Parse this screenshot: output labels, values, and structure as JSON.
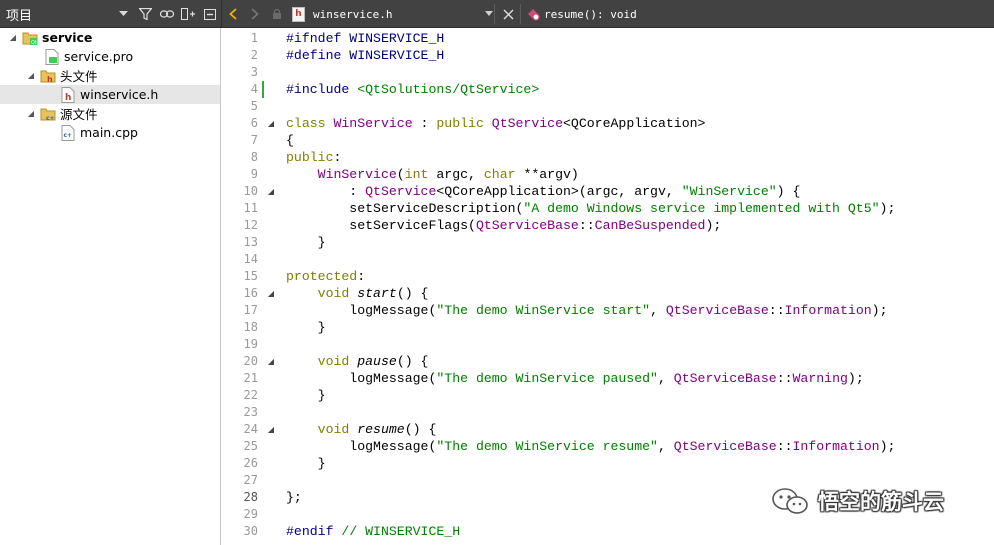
{
  "toolbar": {
    "project_title": "项目",
    "icons": [
      "chevron-down-icon",
      "filter-icon",
      "link-icon",
      "split-icon",
      "close-pane-icon"
    ],
    "current_file": "winservice.h",
    "current_file_icon_glyph": "h",
    "current_symbol": "resume(): void"
  },
  "project_tree": {
    "root": {
      "label": "service"
    },
    "items": [
      {
        "label": "service.pro"
      },
      {
        "label": "头文件"
      },
      {
        "label": "winservice.h"
      },
      {
        "label": "源文件"
      },
      {
        "label": "main.cpp"
      }
    ]
  },
  "editor": {
    "current_line": "28",
    "lines": [
      {
        "n": "1",
        "segs": [
          [
            "pp",
            "#ifndef WINSERVICE_H"
          ]
        ]
      },
      {
        "n": "2",
        "segs": [
          [
            "pp",
            "#define WINSERVICE_H"
          ]
        ]
      },
      {
        "n": "3",
        "segs": []
      },
      {
        "n": "4",
        "segs": [
          [
            "pp",
            "#include "
          ],
          [
            "str",
            "<QtSolutions/QtService>"
          ]
        ]
      },
      {
        "n": "5",
        "segs": []
      },
      {
        "n": "6",
        "segs": [
          [
            "kw",
            "class "
          ],
          [
            "ty",
            "WinService"
          ],
          [
            "",
            " : "
          ],
          [
            "kw",
            "public "
          ],
          [
            "ty",
            "QtService"
          ],
          [
            "",
            "<QCoreApplication>"
          ]
        ]
      },
      {
        "n": "7",
        "segs": [
          [
            "",
            "{"
          ]
        ]
      },
      {
        "n": "8",
        "segs": [
          [
            "kw",
            "public"
          ],
          [
            "",
            ":"
          ]
        ]
      },
      {
        "n": "9",
        "segs": [
          [
            "",
            "    "
          ],
          [
            "ty",
            "WinService"
          ],
          [
            "",
            "("
          ],
          [
            "kw",
            "int"
          ],
          [
            "",
            " argc, "
          ],
          [
            "kw",
            "char"
          ],
          [
            "",
            " **argv)"
          ]
        ]
      },
      {
        "n": "10",
        "segs": [
          [
            "",
            "        : "
          ],
          [
            "ty",
            "QtService"
          ],
          [
            "",
            "<QCoreApplication>(argc, argv, "
          ],
          [
            "str",
            "\"WinService\""
          ],
          [
            "",
            ") {"
          ]
        ]
      },
      {
        "n": "11",
        "segs": [
          [
            "",
            "        setServiceDescription("
          ],
          [
            "str",
            "\"A demo Windows service implemented with Qt5\""
          ],
          [
            "",
            ");"
          ]
        ]
      },
      {
        "n": "12",
        "segs": [
          [
            "",
            "        setServiceFlags("
          ],
          [
            "ty",
            "QtServiceBase"
          ],
          [
            "",
            "::"
          ],
          [
            "ty",
            "CanBeSuspended"
          ],
          [
            "",
            ");"
          ]
        ]
      },
      {
        "n": "13",
        "segs": [
          [
            "",
            "    }"
          ]
        ]
      },
      {
        "n": "14",
        "segs": []
      },
      {
        "n": "15",
        "segs": [
          [
            "kw",
            "protected"
          ],
          [
            "",
            ":"
          ]
        ]
      },
      {
        "n": "16",
        "segs": [
          [
            "",
            "    "
          ],
          [
            "kw",
            "void"
          ],
          [
            "",
            " "
          ],
          [
            "it",
            "start"
          ],
          [
            "",
            "() {"
          ]
        ]
      },
      {
        "n": "17",
        "segs": [
          [
            "",
            "        logMessage("
          ],
          [
            "str",
            "\"The demo WinService start\""
          ],
          [
            "",
            ", "
          ],
          [
            "ty",
            "QtServiceBase"
          ],
          [
            "",
            "::"
          ],
          [
            "ty",
            "Information"
          ],
          [
            "",
            ");"
          ]
        ]
      },
      {
        "n": "18",
        "segs": [
          [
            "",
            "    }"
          ]
        ]
      },
      {
        "n": "19",
        "segs": []
      },
      {
        "n": "20",
        "segs": [
          [
            "",
            "    "
          ],
          [
            "kw",
            "void"
          ],
          [
            "",
            " "
          ],
          [
            "it",
            "pause"
          ],
          [
            "",
            "() {"
          ]
        ]
      },
      {
        "n": "21",
        "segs": [
          [
            "",
            "        logMessage("
          ],
          [
            "str",
            "\"The demo WinService paused\""
          ],
          [
            "",
            ", "
          ],
          [
            "ty",
            "QtServiceBase"
          ],
          [
            "",
            "::"
          ],
          [
            "ty",
            "Warning"
          ],
          [
            "",
            ");"
          ]
        ]
      },
      {
        "n": "22",
        "segs": [
          [
            "",
            "    }"
          ]
        ]
      },
      {
        "n": "23",
        "segs": []
      },
      {
        "n": "24",
        "segs": [
          [
            "",
            "    "
          ],
          [
            "kw",
            "void"
          ],
          [
            "",
            " "
          ],
          [
            "it",
            "resume"
          ],
          [
            "",
            "() {"
          ]
        ]
      },
      {
        "n": "25",
        "segs": [
          [
            "",
            "        logMessage("
          ],
          [
            "str",
            "\"The demo WinService resume\""
          ],
          [
            "",
            ", "
          ],
          [
            "ty",
            "QtServiceBase"
          ],
          [
            "",
            "::"
          ],
          [
            "ty",
            "Information"
          ],
          [
            "",
            ");"
          ]
        ]
      },
      {
        "n": "26",
        "segs": [
          [
            "",
            "    }"
          ]
        ]
      },
      {
        "n": "27",
        "segs": []
      },
      {
        "n": "28",
        "segs": [
          [
            "",
            "};"
          ]
        ]
      },
      {
        "n": "29",
        "segs": []
      },
      {
        "n": "30",
        "segs": [
          [
            "pp",
            "#endif "
          ],
          [
            "cm",
            "// WINSERVICE_H"
          ]
        ]
      }
    ],
    "fold_lines": [
      "6",
      "10",
      "16",
      "20",
      "24"
    ],
    "changed_lines": [
      "4"
    ]
  },
  "watermark": {
    "text": "悟空的筋斗云"
  },
  "colors": {
    "toolbar_bg": "#424242",
    "keyword": "#808000",
    "type": "#800080",
    "preprocessor": "#000080",
    "string": "#008000",
    "selection": "#e6e6e6"
  }
}
